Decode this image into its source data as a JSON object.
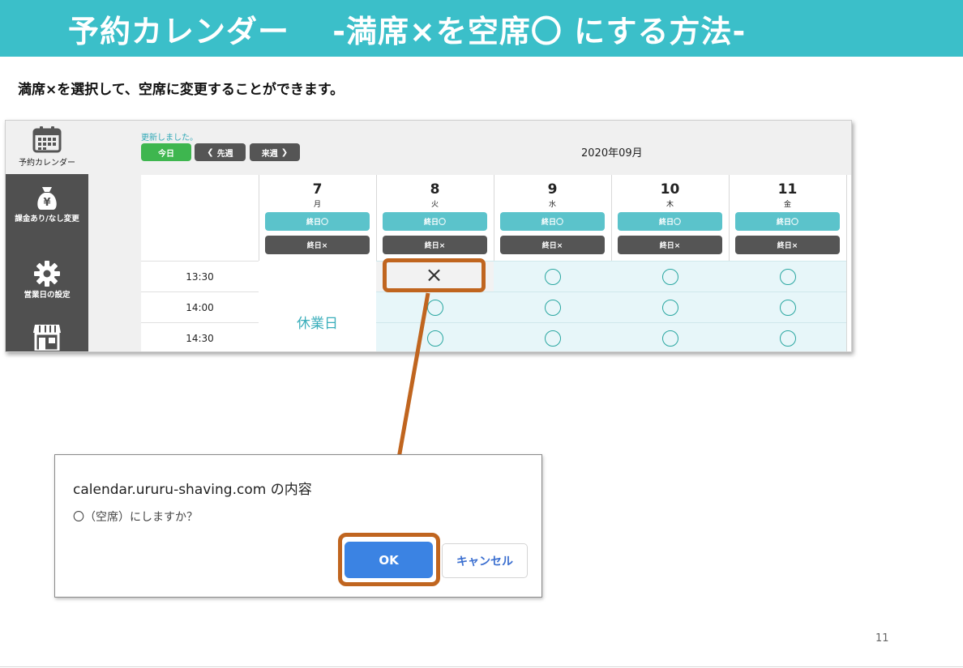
{
  "slide": {
    "title": "予約カレンダー　 -満席×を空席〇 にする方法-",
    "subtitle": "満席×を選択して、空席に変更することができます。",
    "page_number": "11"
  },
  "sidebar": {
    "items": [
      {
        "label": "予約カレンダー",
        "icon": "calendar-icon"
      },
      {
        "label": "課金あり/なし変更",
        "icon": "money-bag-icon"
      },
      {
        "label": "営業日の設定",
        "icon": "gear-icon"
      },
      {
        "label": "",
        "icon": "store-icon"
      }
    ]
  },
  "toolbar": {
    "status": "更新しました。",
    "today": "今日",
    "prev_week": "先週",
    "next_week": "来週",
    "month": "2020年09月"
  },
  "calendar": {
    "day_open_label": "終日〇",
    "day_closed_label": "終日×",
    "holiday_label": "休業日",
    "days": [
      {
        "num": "7",
        "weekday": "月"
      },
      {
        "num": "8",
        "weekday": "火"
      },
      {
        "num": "9",
        "weekday": "水"
      },
      {
        "num": "10",
        "weekday": "木"
      },
      {
        "num": "11",
        "weekday": "金"
      }
    ],
    "times": [
      "13:30",
      "14:00",
      "14:30"
    ],
    "full_mark": "×"
  },
  "dialog": {
    "title": "calendar.ururu-shaving.com の内容",
    "message": "〇（空席）にしますか？",
    "ok": "OK",
    "cancel": "キャンセル"
  },
  "colors": {
    "banner": "#3bbfc9",
    "highlight": "#c0651f",
    "ok_button": "#3b83e3",
    "slot_bg": "#e7f6f9"
  }
}
